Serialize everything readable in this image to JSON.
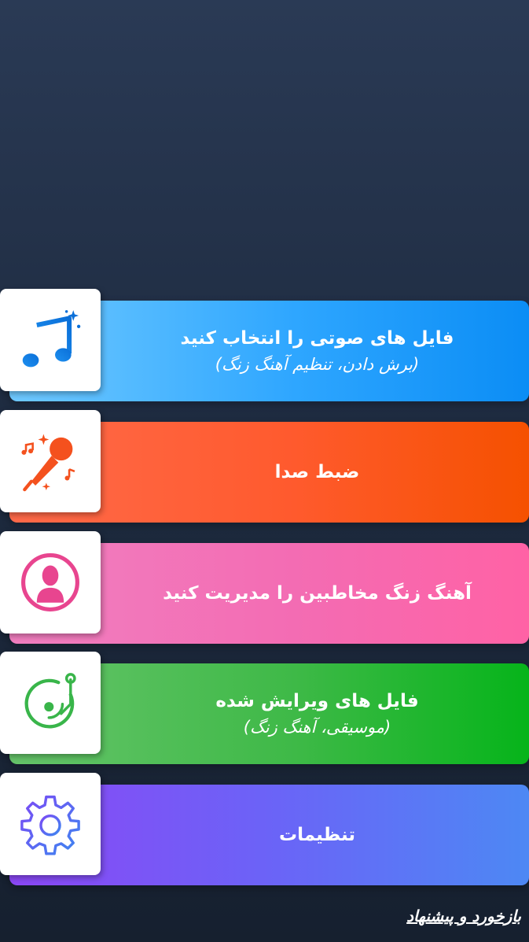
{
  "menu": {
    "items": [
      {
        "title": "فایل های صوتی را انتخاب کنید",
        "subtitle": "(برش دادن، تنظیم آهنگ زنگ)",
        "icon": "music-note-sparkle-icon",
        "color": "#2ea6ff"
      },
      {
        "title": "ضبط صدا",
        "subtitle": "",
        "icon": "microphone-icon",
        "color": "#ff5a2d"
      },
      {
        "title": "آهنگ زنگ مخاطبین را مدیریت کنید",
        "subtitle": "",
        "icon": "contact-person-icon",
        "color": "#f36cb3"
      },
      {
        "title": "فایل های ویرایش شده",
        "subtitle": "(موسیقی، آهنگ زنگ)",
        "icon": "turntable-icon",
        "color": "#3eb947"
      },
      {
        "title": "تنظیمات",
        "subtitle": "",
        "icon": "gear-icon",
        "color": "#6b63f7"
      }
    ]
  },
  "footer": {
    "feedback_label": "بازخورد و پیشنهاد"
  }
}
